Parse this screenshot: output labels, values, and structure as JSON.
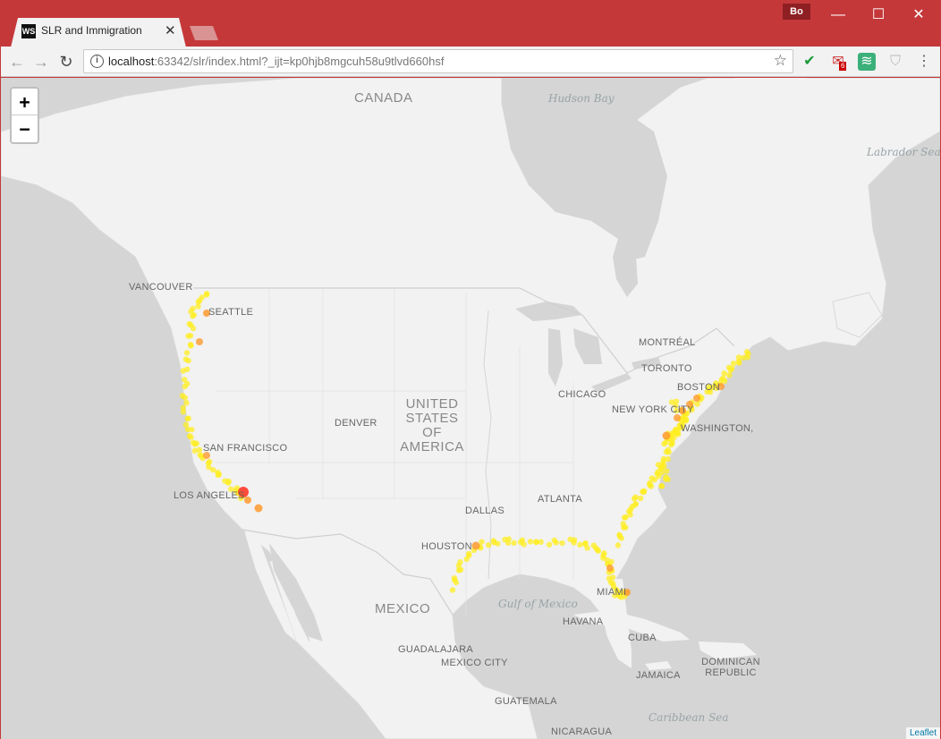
{
  "browser": {
    "tab_title": "SLR and Immigration",
    "tab_favicon": "WS",
    "profile": "Bo",
    "url_host": "localhost",
    "url_rest": ":63342/slr/index.html?_ijt=kp0hjb8mgcuh58u9tlvd660hsf",
    "mail_badge": "6"
  },
  "map": {
    "zoom_in": "+",
    "zoom_out": "−",
    "attribution": "Leaflet",
    "countries": [
      "CANADA",
      "UNITED STATES OF AMERICA",
      "MEXICO"
    ],
    "water": [
      "Hudson Bay",
      "Labrador Sea",
      "Gulf of Mexico",
      "Caribbean Sea"
    ],
    "cities": [
      "VANCOUVER",
      "SEATTLE",
      "SAN FRANCISCO",
      "LOS ANGELES",
      "DENVER",
      "DALLAS",
      "HOUSTON",
      "CHICAGO",
      "TORONTO",
      "MONTRÉAL",
      "BOSTON",
      "NEW YORK CITY",
      "WASHINGTON,",
      "ATLANTA",
      "MIAMI",
      "HAVANA",
      "CUBA",
      "JAMAICA",
      "DOMINICAN REPUBLIC",
      "GUADALAJARA",
      "MEXICO CITY",
      "GUATEMALA",
      "NICARAGUA"
    ],
    "colors": {
      "water": "#d4d5d4",
      "land": "#f2f2f2",
      "low": "#ffee22",
      "mid": "#ff9a30",
      "high": "#ff3a2a"
    }
  }
}
